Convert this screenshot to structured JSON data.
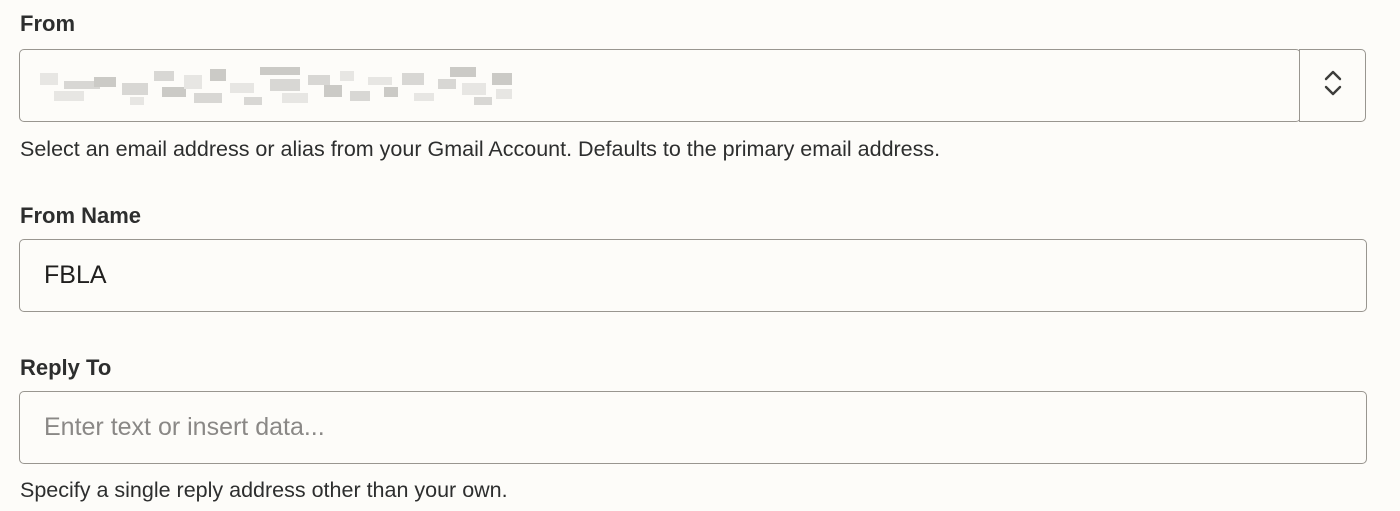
{
  "from": {
    "label": "From",
    "selected_value_redacted": true,
    "help": "Select an email address or alias from your Gmail Account. Defaults to the primary email address.",
    "toggle_icon": "chevron-up-down-icon"
  },
  "from_name": {
    "label": "From Name",
    "value": "FBLA"
  },
  "reply_to": {
    "label": "Reply To",
    "value": "",
    "placeholder": "Enter text or insert data...",
    "help": "Specify a single reply address other than your own."
  }
}
